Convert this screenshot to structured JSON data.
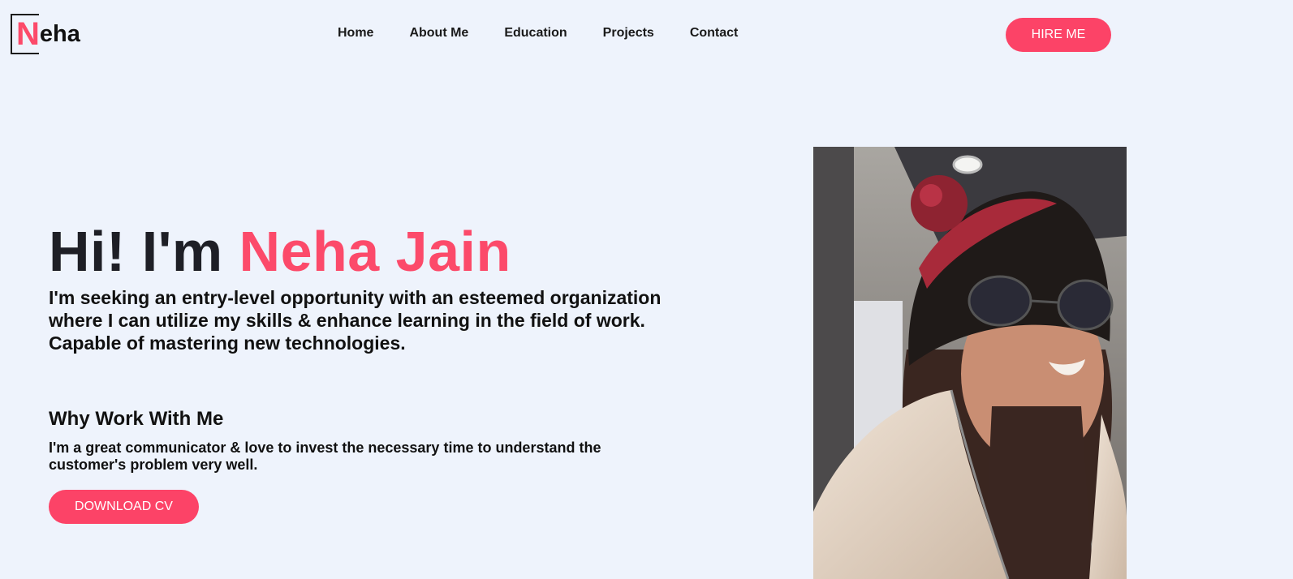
{
  "logo": {
    "first_letter": "N",
    "rest": "eha"
  },
  "nav": {
    "items": [
      {
        "label": "Home"
      },
      {
        "label": "About Me"
      },
      {
        "label": "Education"
      },
      {
        "label": "Projects"
      },
      {
        "label": "Contact"
      }
    ]
  },
  "header": {
    "hire_label": "HIRE ME"
  },
  "hero": {
    "greeting": "Hi! I'm",
    "name": "Neha Jain",
    "intro": "I'm seeking an entry-level opportunity with an esteemed organization where I can utilize my skills & enhance learning in the field of work. Capable of mastering new technologies.",
    "why_title": "Why Work With Me",
    "why_text": "I'm a great communicator & love to invest the necessary time to understand the customer's problem very well.",
    "download_label": "DOWNLOAD CV"
  },
  "colors": {
    "accent": "#fc4367",
    "background": "#eef3fc",
    "text": "#111111"
  }
}
